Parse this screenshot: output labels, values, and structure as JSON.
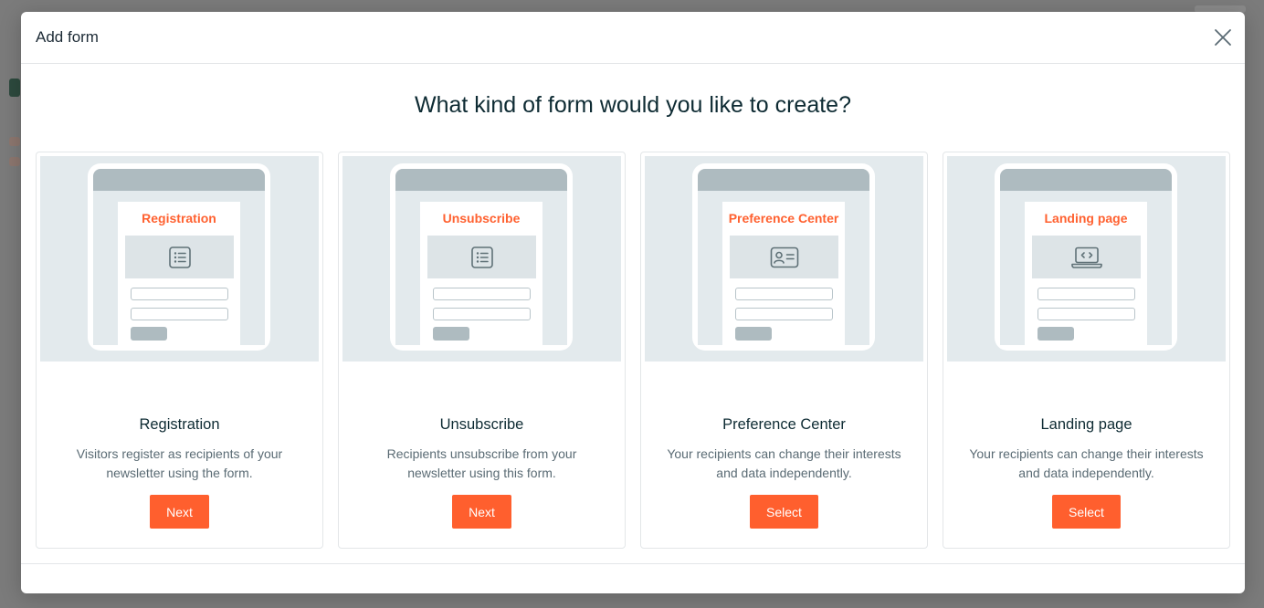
{
  "modal": {
    "title": "Add form",
    "heading": "What kind of form would you like to create?",
    "close_icon": "close-icon"
  },
  "colors": {
    "accent": "#ff5f2e",
    "illustration_bg": "#e3eaed",
    "placeholder_gray": "#aebbc0",
    "heading_text": "#0e2b33"
  },
  "cards": [
    {
      "illustration_label": "Registration",
      "icon": "list-icon",
      "title": "Registration",
      "description": "Visitors register as recipients of your newsletter using the form.",
      "button": "Next"
    },
    {
      "illustration_label": "Unsubscribe",
      "icon": "list-icon",
      "title": "Unsubscribe",
      "description": "Recipients unsubscribe from your newsletter using this form.",
      "button": "Next"
    },
    {
      "illustration_label": "Preference Center",
      "icon": "contact-card-icon",
      "title": "Preference Center",
      "description": "Your recipients can change their interests and data independently.",
      "button": "Select"
    },
    {
      "illustration_label": "Landing page",
      "icon": "laptop-code-icon",
      "title": "Landing page",
      "description": "Your recipients can change their interests and data independently.",
      "button": "Select"
    }
  ]
}
